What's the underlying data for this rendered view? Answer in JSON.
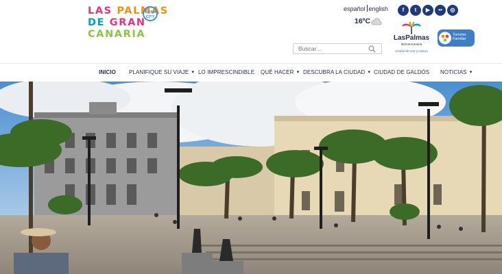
{
  "logo": {
    "lines": [
      {
        "segments": [
          "LAS ",
          "PALMAS"
        ]
      },
      {
        "segments": [
          "DE ",
          "GRAN"
        ]
      },
      {
        "segments": [
          "CANARIA"
        ]
      }
    ],
    "badge_top": "GRAN",
    "badge_bottom": "CITY",
    "colors": [
      "#e6337a",
      "#f39200",
      "#00a0c6",
      "#8cc63f"
    ]
  },
  "language": {
    "spanish": "español",
    "english": "english"
  },
  "weather": {
    "temperature": "16ºC",
    "icon": "cloud-icon"
  },
  "social": [
    {
      "name": "facebook-icon",
      "glyph": "f"
    },
    {
      "name": "twitter-icon",
      "glyph": "t"
    },
    {
      "name": "youtube-icon",
      "glyph": "▶"
    },
    {
      "name": "flickr-icon",
      "glyph": "••"
    },
    {
      "name": "instagram-icon",
      "glyph": "◎"
    }
  ],
  "brand": {
    "name": "LasPalmas",
    "sub": "deGranCanaria",
    "tagline": "Ciudad de mar y cultura"
  },
  "tourism_badge": {
    "line1": "Turismo",
    "line2": "Familiar"
  },
  "search": {
    "placeholder": "Buscar..."
  },
  "nav": [
    {
      "label": "Inicio",
      "active": true,
      "dropdown": false
    },
    {
      "label": "Planifique su viaje",
      "active": false,
      "dropdown": true
    },
    {
      "label": "Lo imprescindible",
      "active": false,
      "dropdown": false
    },
    {
      "label": "Qué hacer",
      "active": false,
      "dropdown": true
    },
    {
      "label": "Descubra la ciudad",
      "active": false,
      "dropdown": true
    },
    {
      "label": "Ciudad de Galdós",
      "active": false,
      "dropdown": false
    },
    {
      "label": "Noticias",
      "active": false,
      "dropdown": true
    }
  ],
  "colors": {
    "navy": "#1d2a4a",
    "social": "#1f3a7a",
    "sky": "#4b8fd0",
    "facade": "#e7d8b6"
  }
}
